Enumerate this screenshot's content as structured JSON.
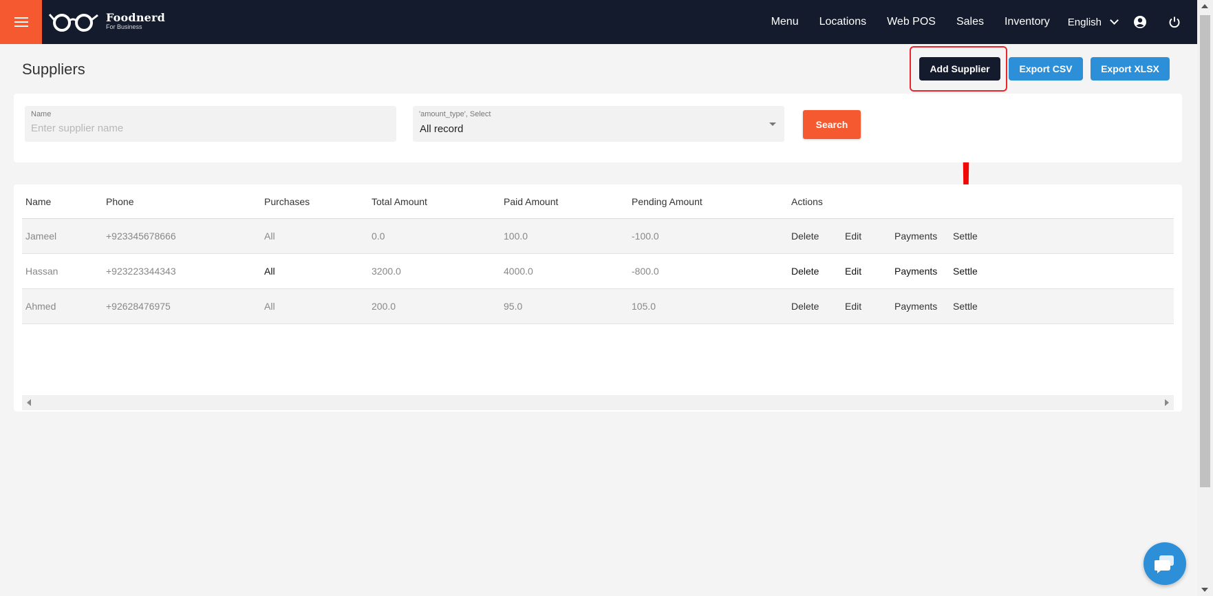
{
  "app": {
    "name": "Foodnerd",
    "subtitle": "For Business"
  },
  "nav": {
    "items": [
      "Menu",
      "Locations",
      "Web POS",
      "Sales",
      "Inventory"
    ],
    "language": "English"
  },
  "page": {
    "title": "Suppliers"
  },
  "actions": {
    "add": "Add Supplier",
    "export_csv": "Export CSV",
    "export_xlsx": "Export XLSX"
  },
  "filters": {
    "name_label": "Name",
    "name_placeholder": "Enter supplier name",
    "type_label": "'amount_type', Select",
    "type_value": "All record",
    "search_label": "Search"
  },
  "table": {
    "headers": [
      "Name",
      "Phone",
      "Purchases",
      "Total Amount",
      "Paid Amount",
      "Pending Amount",
      "Actions"
    ],
    "rows": [
      {
        "name": "Jameel",
        "phone": "+923345678666",
        "purchases": "All",
        "total": "0.0",
        "paid": "100.0",
        "pending": "-100.0"
      },
      {
        "name": "Hassan",
        "phone": "+923223344343",
        "purchases": "All",
        "total": "3200.0",
        "paid": "4000.0",
        "pending": "-800.0"
      },
      {
        "name": "Ahmed",
        "phone": "+92628476975",
        "purchases": "All",
        "total": "200.0",
        "paid": "95.0",
        "pending": "105.0"
      }
    ],
    "actions": {
      "delete": "Delete",
      "edit": "Edit",
      "payments": "Payments",
      "settle": "Settle"
    }
  },
  "icons": {
    "account": "account-circle-icon",
    "power": "power-icon",
    "chat": "chat-icon"
  },
  "colors": {
    "accent": "#f4592f",
    "topbar": "#141b2d",
    "primary_blue": "#2d8fd8",
    "highlight": "#e9252c"
  }
}
